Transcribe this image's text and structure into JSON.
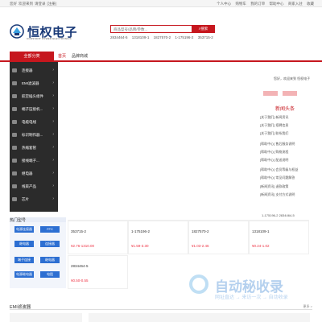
{
  "topbar": {
    "greeting": [
      "您好",
      "欢迎来到",
      "请登录",
      "[注册]"
    ],
    "links": [
      "个人中心",
      "购物车",
      "我的订单",
      "帮助中心",
      "商家入驻",
      "收藏"
    ]
  },
  "logo": {
    "name": "恒权电子",
    "subtitle": "CONSTANT POWER ELECTRONICS"
  },
  "search": {
    "placeholder": "商品型号/品牌/参数...",
    "button": "搜索",
    "hot": [
      "2834464-5",
      "1318109-1",
      "1827570-2",
      "1-175196-2",
      "353715-2"
    ]
  },
  "nav": {
    "all": "全部分类",
    "items": [
      "首页",
      "品牌商城"
    ]
  },
  "categories": [
    {
      "label": "连接器"
    },
    {
      "label": "EMI滤波器"
    },
    {
      "label": "航空插头组件"
    },
    {
      "label": "端子压接机..."
    },
    {
      "label": "电缆电线"
    },
    {
      "label": "标识制作器..."
    },
    {
      "label": "热缩套管"
    },
    {
      "label": "接线端子..."
    },
    {
      "label": "继电器"
    },
    {
      "label": "线束产品"
    },
    {
      "label": "芯片"
    }
  ],
  "news": {
    "breadcrumb": "您好，欢迎来到 恒权电子",
    "title": "新闻头条",
    "items": [
      "[关于我们] 新闻资讯",
      "[关于我们] 招聘信息",
      "[关于我们] 联系我们",
      "[帮助中心] 售后服务说明",
      "[帮助中心] 购物流程",
      "[帮助中心] 配送说明",
      "[帮助中心] 会员等级与权益",
      "[帮助中心] 常见问题解答",
      "[新闻资讯] 退款政策",
      "[新闻资讯] 支付方式说明"
    ]
  },
  "pagination": "1-175196-2    2834464-5",
  "quicktags": {
    "title": "热门型号",
    "tags": [
      "电源连接器",
      "FFC",
      "继电器",
      "连接器",
      "端子连接",
      "继电器",
      "电源继电器",
      "电阻"
    ]
  },
  "products": [
    {
      "pn": "353715-2",
      "price": "¥2.76-1310.00"
    },
    {
      "pn": "1-175196-2",
      "price": "¥1.59-3.30"
    },
    {
      "pn": "1827570-2",
      "price": "¥1.03-2.46"
    },
    {
      "pn": "1318109-1",
      "price": "¥0.24-1.02"
    },
    {
      "pn": "2834464-5",
      "price": "¥0.50-0.55"
    }
  ],
  "watermark": {
    "text": "自动秘收录",
    "sub": "网址直达 → 来访一次 → 自动收录"
  },
  "section2": {
    "title": "EMI滤波器",
    "more": "更多 >"
  },
  "colors": {
    "brand_red": "#c6171e",
    "navy": "#1a3a78",
    "tag_blue": "#2d6fd2"
  }
}
